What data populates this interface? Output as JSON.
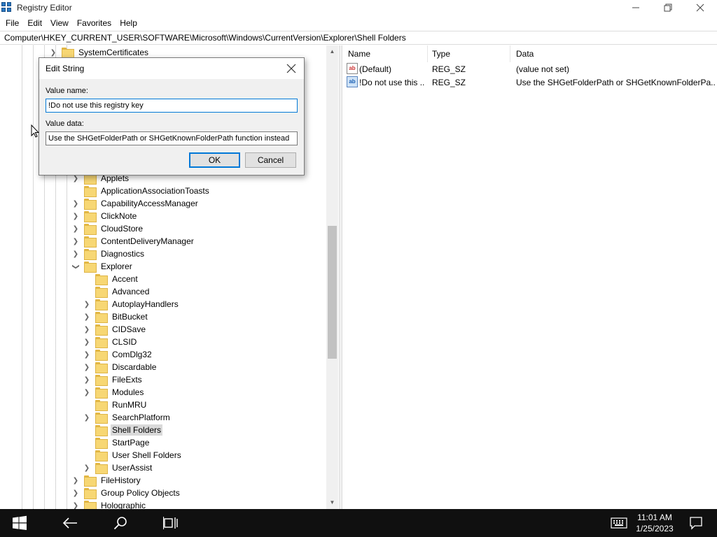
{
  "window": {
    "title": "Registry Editor"
  },
  "menu": [
    "File",
    "Edit",
    "View",
    "Favorites",
    "Help"
  ],
  "address": "Computer\\HKEY_CURRENT_USER\\SOFTWARE\\Microsoft\\Windows\\CurrentVersion\\Explorer\\Shell Folders",
  "tree": {
    "top_item": "SystemCertificates",
    "level1": [
      "Applets",
      "ApplicationAssociationToasts",
      "CapabilityAccessManager",
      "ClickNote",
      "CloudStore",
      "ContentDeliveryManager",
      "Diagnostics",
      "Explorer"
    ],
    "explorer_children": [
      "Accent",
      "Advanced",
      "AutoplayHandlers",
      "BitBucket",
      "CIDSave",
      "CLSID",
      "ComDlg32",
      "Discardable",
      "FileExts",
      "Modules",
      "RunMRU",
      "SearchPlatform",
      "Shell Folders",
      "StartPage",
      "User Shell Folders",
      "UserAssist"
    ],
    "after": [
      "FileHistory",
      "Group Policy Objects",
      "Holographic"
    ],
    "selected": "Shell Folders"
  },
  "list": {
    "headers": {
      "name": "Name",
      "type": "Type",
      "data": "Data"
    },
    "rows": [
      {
        "name": "(Default)",
        "type": "REG_SZ",
        "data": "(value not set)"
      },
      {
        "name": "!Do not use this ...",
        "type": "REG_SZ",
        "data": "Use the SHGetFolderPath or SHGetKnownFolderPa..."
      }
    ]
  },
  "dialog": {
    "title": "Edit String",
    "value_name_label": "Value name:",
    "value_name": "!Do not use this registry key",
    "value_data_label": "Value data:",
    "value_data": "Use the SHGetFolderPath or SHGetKnownFolderPath function instead",
    "ok_label": "OK",
    "cancel_label": "Cancel"
  },
  "taskbar": {
    "time": "11:01 AM",
    "date": "1/25/2023"
  },
  "colors": {
    "accent": "#0078d7",
    "taskbar": "#101010",
    "folder": "#f7d774"
  }
}
